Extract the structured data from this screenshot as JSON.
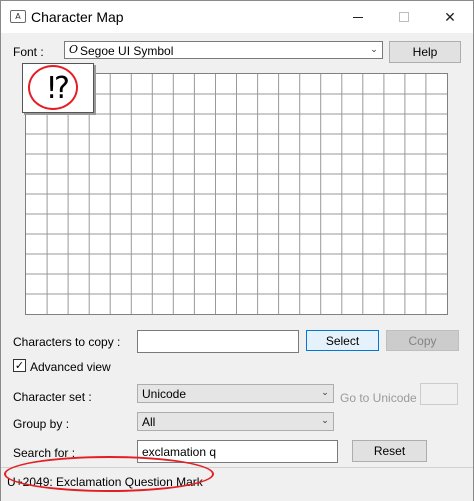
{
  "window": {
    "title": "Character Map",
    "app_icon": "character-map-app-icon",
    "close_glyph": "✕"
  },
  "font_row": {
    "label": "Font :",
    "value": "Segoe UI Symbol",
    "font_icon_glyph": "O",
    "help_label": "Help"
  },
  "grid": {
    "rows": 12,
    "cols": 20,
    "selected_char": "⁉"
  },
  "copy_row": {
    "label": "Characters to copy :",
    "value": "",
    "select_label": "Select",
    "copy_label": "Copy"
  },
  "advanced": {
    "label": "Advanced view",
    "checked": true,
    "check_glyph": "✓"
  },
  "charset": {
    "label": "Character set :",
    "value": "Unicode",
    "goto_label": "Go to Unicode :"
  },
  "groupby": {
    "label": "Group by :",
    "value": "All"
  },
  "search": {
    "label": "Search for :",
    "value": "exclamation q",
    "reset_label": "Reset"
  },
  "status": {
    "text": "U+2049: Exclamation Question Mark"
  },
  "colors": {
    "annotation": "#e31e24",
    "select_border": "#0078d7"
  }
}
